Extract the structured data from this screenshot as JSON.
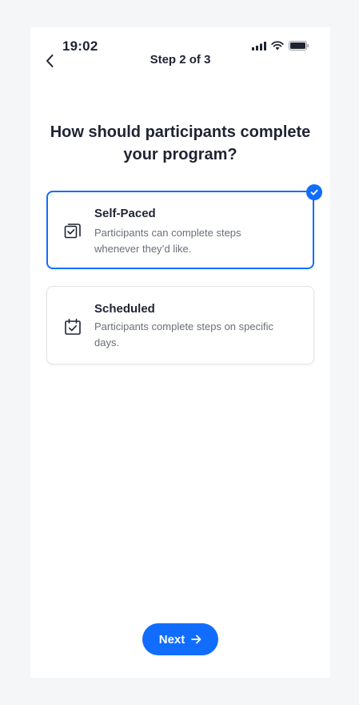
{
  "status_bar": {
    "time": "19:02"
  },
  "header": {
    "step_title": "Step 2 of 3"
  },
  "question": "How should participants complete your program?",
  "options": [
    {
      "title": "Self-Paced",
      "description": "Participants can complete steps whenever they’d like.",
      "icon": "stacked-checkbox-icon",
      "selected": true
    },
    {
      "title": "Scheduled",
      "description": "Participants complete steps on specific days.",
      "icon": "calendar-check-icon",
      "selected": false
    }
  ],
  "footer": {
    "next_label": "Next"
  },
  "colors": {
    "accent": "#116dff",
    "text": "#1f2433",
    "muted": "#6a6f7a",
    "border": "#e1e3e8"
  }
}
